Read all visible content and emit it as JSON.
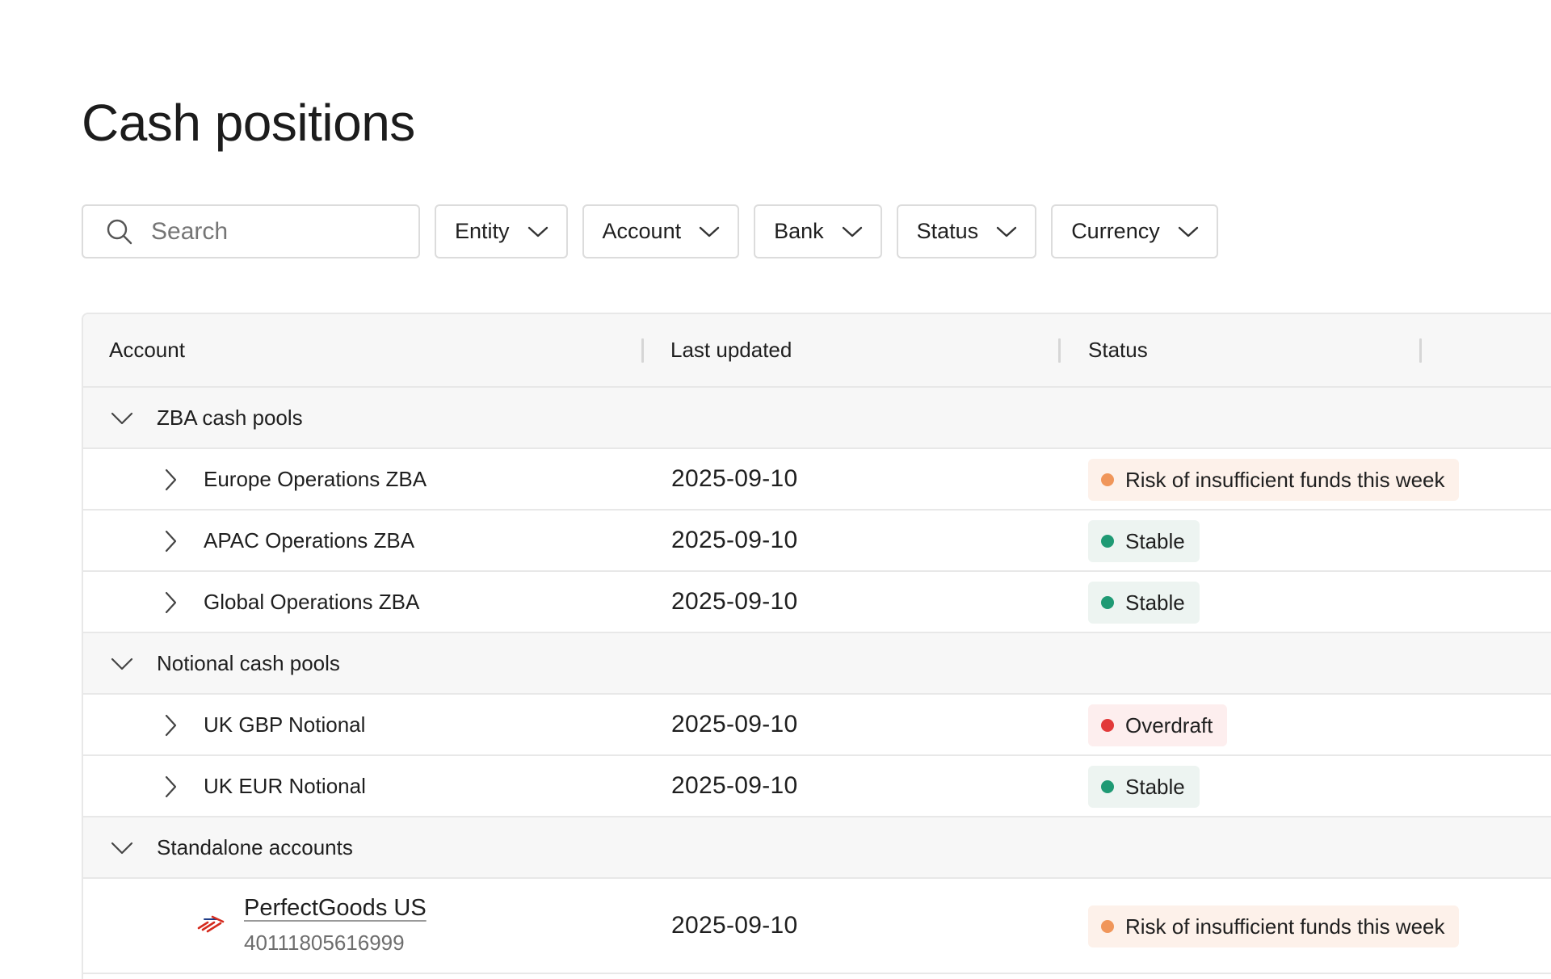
{
  "page": {
    "title": "Cash positions"
  },
  "filters": {
    "search_placeholder": "Search",
    "entity": "Entity",
    "account": "Account",
    "bank": "Bank",
    "status": "Status",
    "currency": "Currency"
  },
  "table": {
    "columns": {
      "account": "Account",
      "last_updated": "Last updated",
      "status": "Status"
    },
    "groups": [
      {
        "label": "ZBA cash pools",
        "rows": [
          {
            "name": "Europe Operations ZBA",
            "updated": "2025-09-10",
            "status": "Risk of insufficient funds this week",
            "status_type": "risk"
          },
          {
            "name": "APAC Operations ZBA",
            "updated": "2025-09-10",
            "status": "Stable",
            "status_type": "stable"
          },
          {
            "name": "Global Operations ZBA",
            "updated": "2025-09-10",
            "status": "Stable",
            "status_type": "stable"
          }
        ]
      },
      {
        "label": "Notional cash pools",
        "rows": [
          {
            "name": "UK GBP Notional",
            "updated": "2025-09-10",
            "status": "Overdraft",
            "status_type": "overdraft"
          },
          {
            "name": "UK EUR Notional",
            "updated": "2025-09-10",
            "status": "Stable",
            "status_type": "stable"
          }
        ]
      },
      {
        "label": "Standalone accounts",
        "rows": [
          {
            "name": "PerfectGoods US",
            "number": "40111805616999",
            "bank_icon": "bank-logo-icon",
            "updated": "2025-09-10",
            "status": "Risk of insufficient funds this week",
            "status_type": "risk"
          }
        ]
      }
    ]
  },
  "colors": {
    "risk_dot": "#f0965a",
    "stable_dot": "#1f9a74",
    "overdraft_dot": "#e23a3a",
    "bank_logo": "#d52b1e"
  }
}
